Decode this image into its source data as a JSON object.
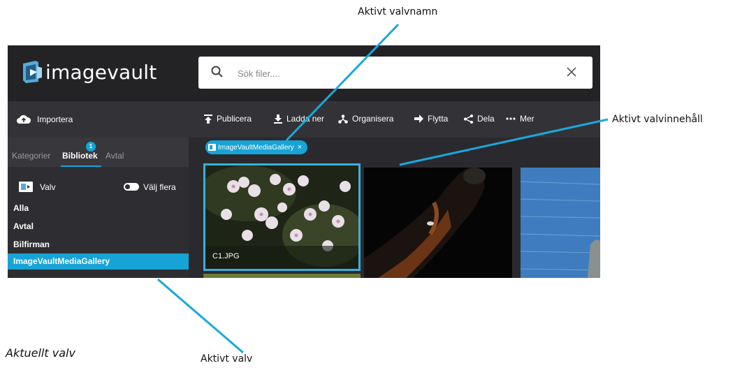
{
  "annotations": {
    "active_vault_name": "Aktivt valvnamn",
    "active_vault_content": "Aktivt valvinnehåll",
    "active_vault": "Aktivt valv",
    "current_vault": "Aktuellt valv"
  },
  "app": {
    "logo_text": "imagevault",
    "search_placeholder": "Sök filer....",
    "import_label": "Importera",
    "tabs": [
      {
        "label": "Kategorier",
        "active": false
      },
      {
        "label": "Bibliotek",
        "active": true,
        "badge": "1"
      },
      {
        "label": "Avtal",
        "active": false
      }
    ],
    "vault_header": {
      "label": "Valv",
      "multi_select_label": "Välj flera"
    },
    "vaults": [
      "Alla",
      "Avtal",
      "Bilfirman",
      "ImageVaultMediaGallery"
    ],
    "selected_vault": "ImageVaultMediaGallery",
    "toolbar": [
      {
        "label": "Publicera",
        "icon": "publish-icon"
      },
      {
        "label": "Ladda ner",
        "icon": "download-icon"
      },
      {
        "label": "Organisera",
        "icon": "organize-icon"
      },
      {
        "label": "Flytta",
        "icon": "move-arrow-icon"
      },
      {
        "label": "Dela",
        "icon": "share-icon"
      },
      {
        "label": "Mer",
        "icon": "more-dots-icon"
      }
    ],
    "active_filter_chip": "ImageVaultMediaGallery",
    "thumbnails": [
      {
        "caption": "C1.JPG",
        "selected": true
      },
      {
        "caption": "",
        "selected": false
      },
      {
        "caption": "",
        "selected": false
      }
    ]
  },
  "colors": {
    "accent": "#18a3d6",
    "header_bg": "#232326",
    "sidebar_bg": "#2e2e32",
    "annotation_line": "#1aa8dc"
  }
}
